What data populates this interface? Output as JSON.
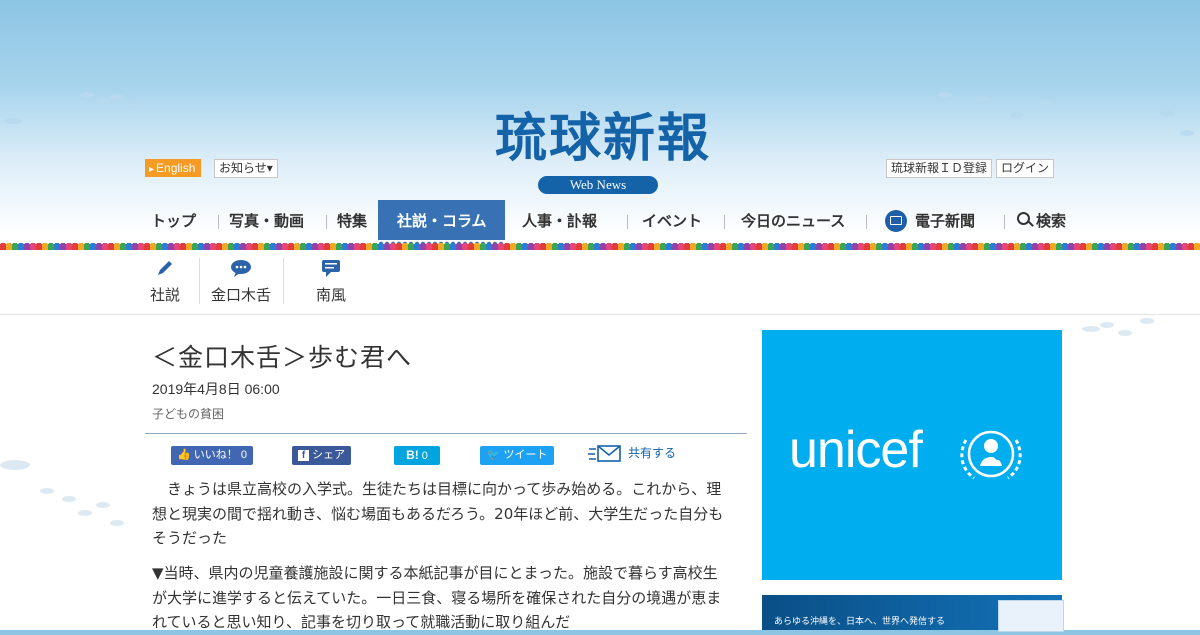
{
  "header": {
    "lang_button": "English",
    "notice_button": "お知らせ▾",
    "logo": "琉球新報",
    "logo_sub": "Web News",
    "register": "琉球新報ＩＤ登録",
    "login": "ログイン"
  },
  "nav": {
    "items": [
      "トップ",
      "写真・動画",
      "特集",
      "社説・コラム",
      "人事・訃報",
      "イベント",
      "今日のニュース",
      "電子新聞",
      "検索"
    ],
    "active": "社説・コラム"
  },
  "subnav": {
    "items": [
      "社説",
      "金口木舌",
      "南風"
    ]
  },
  "article": {
    "title": "＜金口木舌＞歩む君へ",
    "date": "2019年4月8日 06:00",
    "tag": "子どもの貧困",
    "paragraphs": [
      "　きょうは県立高校の入学式。生徒たちは目標に向かって歩み始める。これから、理想と現実の間で揺れ動き、悩む場面もあるだろう。20年ほど前、大学生だった自分もそうだった",
      "▼当時、県内の児童養護施設に関する本紙記事が目にとまった。施設で暮らす高校生が大学に進学すると伝えていた。一日三食、寝る場所を確保された自分の境遇が恵まれていると思い知り、記事を切り取って就職活動に取り組んだ"
    ]
  },
  "share": {
    "like_label": "いいね！",
    "like_count": "0",
    "fb_share": "シェア",
    "hatena_label": "B!",
    "hatena_count": "0",
    "tweet": "ツイート",
    "share_all": "共有する"
  },
  "ads": {
    "unicef": "unicef",
    "banner_text": "あらゆる沖縄を、日本へ、世界へ発信する"
  },
  "colors": {
    "brand_blue": "#1462a8",
    "active_nav": "#3872b5",
    "unicef_blue": "#00aeef",
    "lang_orange": "#f59a23"
  }
}
